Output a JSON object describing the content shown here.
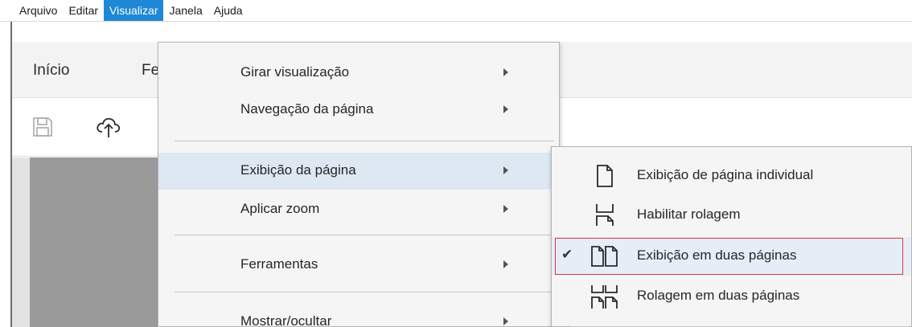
{
  "menubar": {
    "items": [
      {
        "label": "Arquivo",
        "active": false
      },
      {
        "label": "Editar",
        "active": false
      },
      {
        "label": "Visualizar",
        "active": true
      },
      {
        "label": "Janela",
        "active": false
      },
      {
        "label": "Ajuda",
        "active": false
      }
    ]
  },
  "tabs": {
    "home": "Início",
    "partial": "Fe"
  },
  "toolbar": {
    "icons": [
      "save-icon",
      "cloud-upload-icon"
    ]
  },
  "view_menu": {
    "items": [
      {
        "label": "Girar visualização",
        "has_submenu": true
      },
      {
        "label": "Navegação da página",
        "has_submenu": true
      },
      {
        "label": "Exibição da página",
        "has_submenu": true,
        "highlighted": true
      },
      {
        "label": "Aplicar zoom",
        "has_submenu": true
      },
      {
        "label": "Ferramentas",
        "has_submenu": true
      },
      {
        "label": "Mostrar/ocultar",
        "has_submenu": true
      }
    ]
  },
  "page_display_submenu": {
    "items": [
      {
        "label": "Exibição de página individual",
        "icon": "single-page-icon",
        "checked": false
      },
      {
        "label": "Habilitar rolagem",
        "icon": "scrolling-icon",
        "checked": false
      },
      {
        "label": "Exibição em duas páginas",
        "icon": "two-page-icon",
        "checked": true
      },
      {
        "label": "Rolagem em duas páginas",
        "icon": "two-page-scrolling-icon",
        "checked": false
      }
    ],
    "check_glyph": "✔"
  },
  "colors": {
    "menu_active": "#1e88d6",
    "highlight": "#dde8f3",
    "focus_border": "#e0373f"
  }
}
